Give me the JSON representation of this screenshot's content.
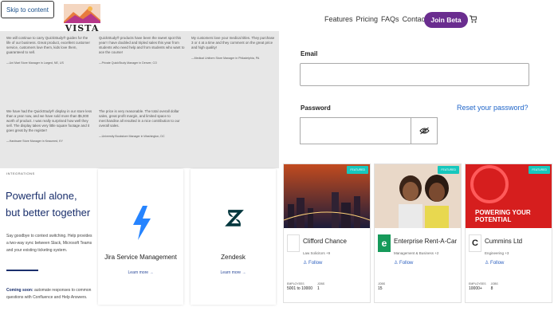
{
  "header": {
    "skip_label": "Skip to content",
    "logo_text": "VISTA",
    "logo_subtext": "LIFE IS GOOD",
    "nav": [
      "Features",
      "Pricing",
      "FAQs",
      "Contact"
    ],
    "join_label": "Join Beta",
    "cart_icon": "cart-icon"
  },
  "testimonials": [
    {
      "quote": "We will continue to carry QuickStudy® guides for the life of our business. Great product, excellent customer service, customers love them, kids love them, guaranteed to sell.",
      "author": "—Uni Mart Store Manager in Larged, NE, US"
    },
    {
      "quote": "QuickStudy® products have been the sweet spot this year! I have doubled and tripled sales this year from students who need help and from students who want to ace the course!",
      "author": "—Private QuickStudy Manager in Denver, CO"
    },
    {
      "quote": "My customers love your medical titles. They purchase 3 or 4 at a time and they comment on the great price and high quality!",
      "author": "—Medical Uniform Store Manager in Philadelphia, PA"
    },
    {
      "quote": "We have had the QuickStudy® display in our store less than a year now, and we have sold more than $5,000 worth of product. I was really surprised how well they sell. The display takes very little square footage and it goes great by the register!",
      "author": "—Hardware Store Manager in Keaumed, KY"
    },
    {
      "quote": "The price is very reasonable. The total overall dollar sales, great profit margin, and limited space to merchandise all resulted in a nice contribution to our overall sales.",
      "author": "—University Bookstore Manager in Washington, DC"
    }
  ],
  "login": {
    "email_label": "Email",
    "email_value": "",
    "password_label": "Password",
    "password_value": "",
    "reset_link": "Reset your password?",
    "eye_icon": "eye-off-icon"
  },
  "integrations": {
    "label": "INTEGRATIONS",
    "title": "Powerful alone, but better together",
    "description": "Say goodbye to context switching. Help provides a two-way sync between Slack, Microsoft Teams and your existing ticketing system.",
    "note_bold": "Coming soon:",
    "note_text": " automate responses to common questions with Confluence and Help Answers.",
    "apps": [
      {
        "name": "Jira Service Management",
        "link": "Learn more →",
        "icon": "lightning-icon",
        "color": "#2684ff"
      },
      {
        "name": "Zendesk",
        "link": "Learn more →",
        "icon": "zendesk-icon",
        "color": "#03363d"
      }
    ]
  },
  "companies": [
    {
      "badge": "FEATURED",
      "name": "Clifford Chance",
      "meta": "Law Solicitors +9",
      "follow": "Follow",
      "stat1_label": "EMPLOYEES",
      "stat1_value": "5001 to 10000",
      "stat2_label": "JOBS",
      "stat2_value": "1",
      "image": "city-night",
      "logo_icon": "clifford-chance-logo"
    },
    {
      "badge": "FEATURED",
      "name": "Enterprise Rent-A-Car",
      "meta": "Management & Business +2",
      "follow": "Follow",
      "stat1_label": "JOBS",
      "stat1_value": "15",
      "stat2_label": "",
      "stat2_value": "",
      "image": "two-women",
      "logo_icon": "enterprise-logo"
    },
    {
      "badge": "FEATURED",
      "name": "Cummins Ltd",
      "meta": "Engineering +3",
      "follow": "Follow",
      "stat1_label": "EMPLOYEES",
      "stat1_value": "10000+",
      "stat2_label": "JOBS",
      "stat2_value": "8",
      "image_text": "POWERING YOUR POTENTIAL",
      "logo_icon": "cummins-logo"
    }
  ]
}
